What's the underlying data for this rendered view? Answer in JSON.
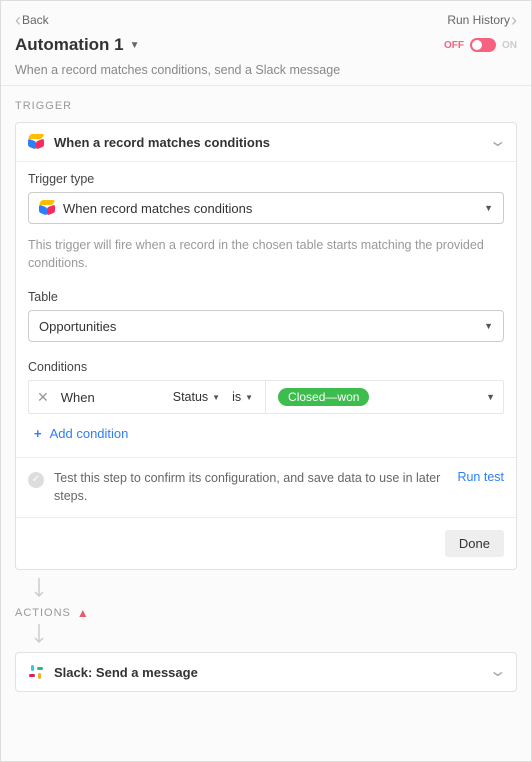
{
  "header": {
    "back_label": "Back",
    "run_history_label": "Run History",
    "title": "Automation 1",
    "toggle_off": "OFF",
    "toggle_on": "ON",
    "description": "When a record matches conditions, send a Slack message"
  },
  "trigger": {
    "section_label": "TRIGGER",
    "title": "When a record matches conditions",
    "type_label": "Trigger type",
    "type_value": "When record matches conditions",
    "help_text": "This trigger will fire when a record in the chosen table starts matching the provided conditions.",
    "table_label": "Table",
    "table_value": "Opportunities",
    "conditions_label": "Conditions",
    "condition": {
      "when": "When",
      "field": "Status",
      "operator": "is",
      "value": "Closed—won"
    },
    "add_condition": "Add condition",
    "test_text": "Test this step to confirm its configuration, and save data to use in later steps.",
    "run_test": "Run test",
    "done": "Done"
  },
  "actions": {
    "section_label": "ACTIONS",
    "slack_title": "Slack: Send a message"
  }
}
